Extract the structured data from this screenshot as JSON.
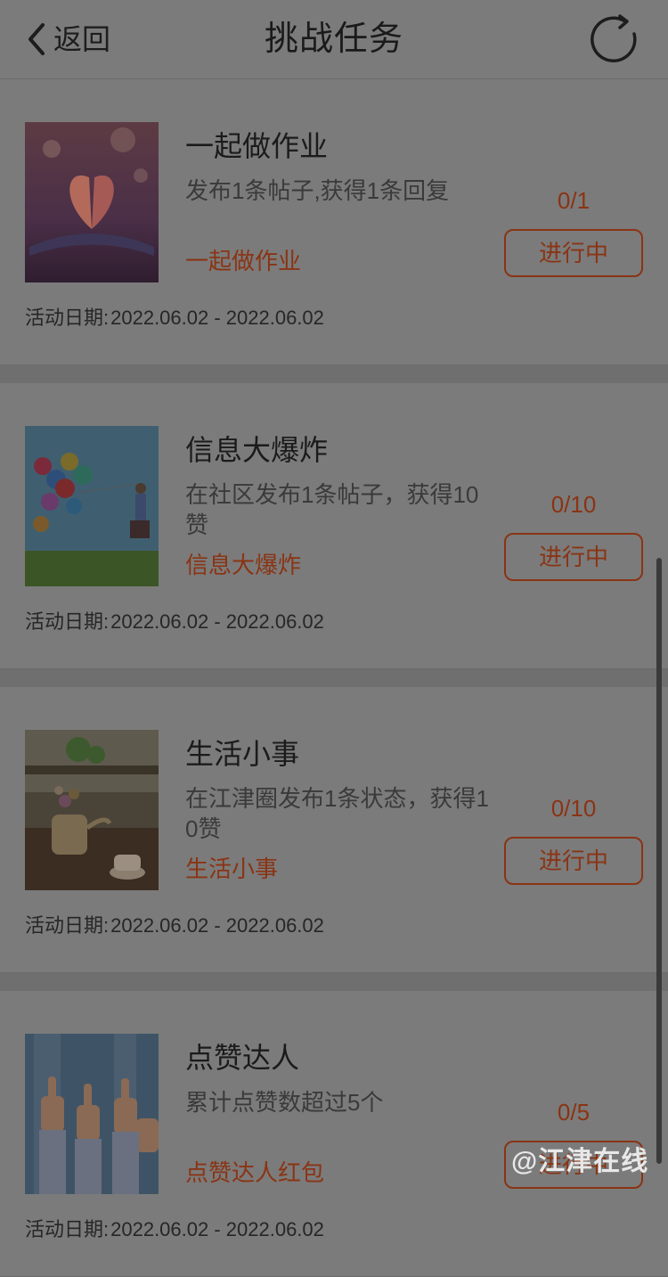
{
  "header": {
    "back_label": "返回",
    "title": "挑战任务",
    "refresh_icon": "refresh-icon"
  },
  "dates_label": "活动日期:",
  "tasks": [
    {
      "title": "一起做作业",
      "description": "发布1条帖子,获得1条回复",
      "reward": "一起做作业",
      "progress": "0/1",
      "status": "进行中",
      "dates": "2022.06.02 - 2022.06.02"
    },
    {
      "title": "信息大爆炸",
      "description": "在社区发布1条帖子，获得10赞",
      "reward": "信息大爆炸",
      "progress": "0/10",
      "status": "进行中",
      "dates": "2022.06.02 - 2022.06.02"
    },
    {
      "title": "生活小事",
      "description": "在江津圈发布1条状态，获得10赞",
      "reward": "生活小事",
      "progress": "0/10",
      "status": "进行中",
      "dates": "2022.06.02 - 2022.06.02"
    },
    {
      "title": "点赞达人",
      "description": "累计点赞数超过5个",
      "reward": "点赞达人红包",
      "progress": "0/5",
      "status": "进行中",
      "dates": "2022.06.02 - 2022.06.02"
    }
  ],
  "watermark": "@江津在线",
  "colors": {
    "overlay_background": "#7b7b7b",
    "accent": "#8a3414"
  }
}
